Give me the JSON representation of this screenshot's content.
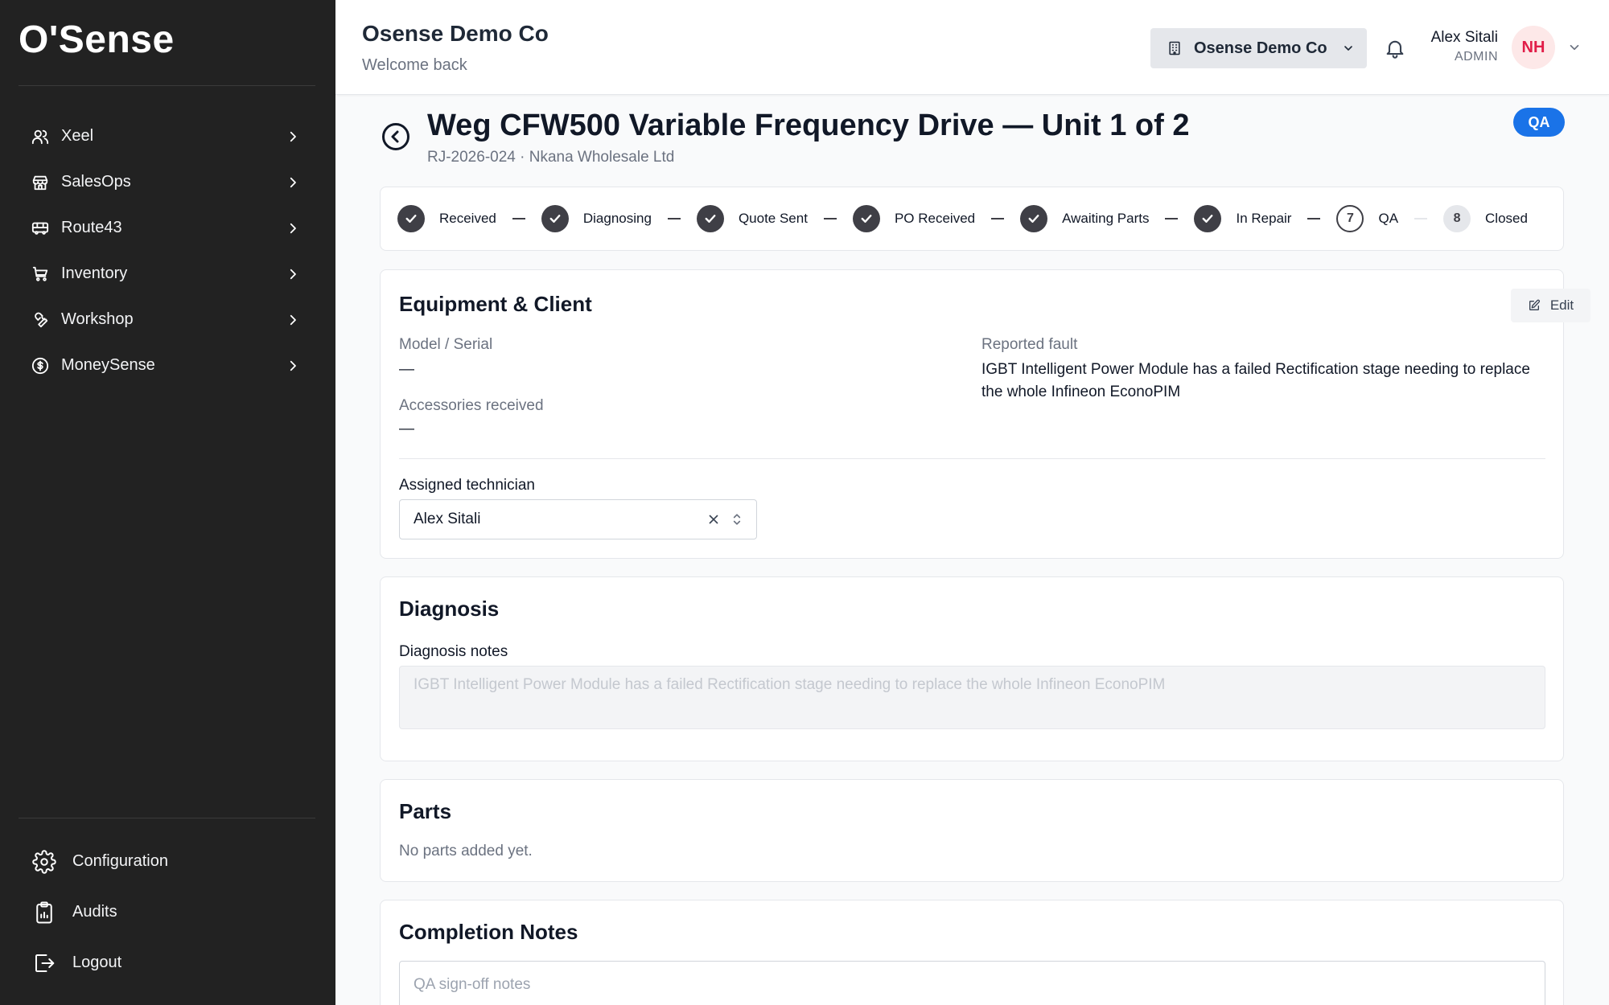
{
  "sidebar": {
    "brand": "O'Sense",
    "items": [
      {
        "label": "Xeel",
        "icon": "users-icon"
      },
      {
        "label": "SalesOps",
        "icon": "store-icon"
      },
      {
        "label": "Route43",
        "icon": "bus-icon"
      },
      {
        "label": "Inventory",
        "icon": "cart-icon"
      },
      {
        "label": "Workshop",
        "icon": "wrench-icon"
      },
      {
        "label": "MoneySense",
        "icon": "dollar-circle-icon"
      }
    ],
    "bottom_items": [
      {
        "label": "Configuration",
        "icon": "gear-icon"
      },
      {
        "label": "Audits",
        "icon": "clipboard-icon"
      },
      {
        "label": "Logout",
        "icon": "logout-icon"
      }
    ]
  },
  "header": {
    "company": "Osense Demo Co",
    "welcome": "Welcome back",
    "org_switch_label": "Osense Demo Co",
    "user_name": "Alex Sitali",
    "user_role": "ADMIN",
    "avatar_initials": "NH"
  },
  "page": {
    "title": "Weg CFW500 Variable Frequency Drive — Unit 1 of 2",
    "subtitle": "RJ-2026-024 · Nkana Wholesale Ltd",
    "status": "QA",
    "status_color": "#1a73e8"
  },
  "steps": [
    {
      "label": "Received",
      "state": "done",
      "number": "1"
    },
    {
      "label": "Diagnosing",
      "state": "done",
      "number": "2"
    },
    {
      "label": "Quote Sent",
      "state": "done",
      "number": "3"
    },
    {
      "label": "PO Received",
      "state": "done",
      "number": "4"
    },
    {
      "label": "Awaiting Parts",
      "state": "done",
      "number": "5"
    },
    {
      "label": "In Repair",
      "state": "done",
      "number": "6"
    },
    {
      "label": "QA",
      "state": "current",
      "number": "7"
    },
    {
      "label": "Closed",
      "state": "pending",
      "number": "8"
    }
  ],
  "equipment": {
    "title": "Equipment & Client",
    "edit_label": "Edit",
    "model_label": "Model / Serial",
    "model_value": "—",
    "accessories_label": "Accessories received",
    "accessories_value": "—",
    "fault_label": "Reported fault",
    "fault_value": "IGBT Intelligent Power Module has a failed Rectification stage needing to replace the whole Infineon EconoPIM",
    "technician_label": "Assigned technician",
    "technician_value": "Alex Sitali"
  },
  "diagnosis": {
    "title": "Diagnosis",
    "notes_label": "Diagnosis notes",
    "notes_value": "IGBT Intelligent Power Module has a failed Rectification stage needing to replace the whole Infineon EconoPIM"
  },
  "parts": {
    "title": "Parts",
    "empty": "No parts added yet."
  },
  "completion": {
    "title": "Completion Notes",
    "placeholder": "QA sign-off notes"
  }
}
